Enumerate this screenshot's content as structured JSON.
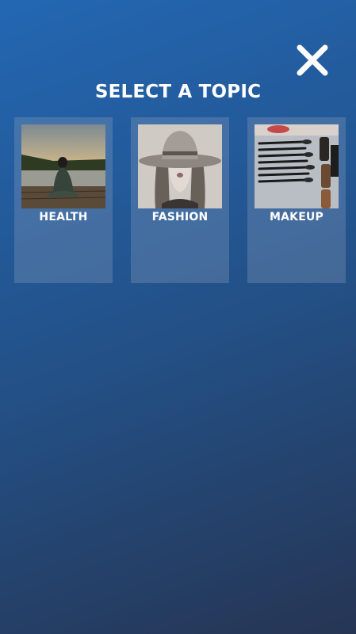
{
  "header": {
    "title": "SELECT A TOPIC",
    "close_icon": "close-icon"
  },
  "topics": [
    {
      "label": "HEALTH",
      "image": "meditation-lake-photo"
    },
    {
      "label": "FASHION",
      "image": "woman-wide-hat-photo"
    },
    {
      "label": "MAKEUP",
      "image": "makeup-brushes-photo"
    }
  ],
  "colors": {
    "background_top": "#2367b3",
    "background_bottom": "#263554",
    "text": "#ffffff"
  }
}
